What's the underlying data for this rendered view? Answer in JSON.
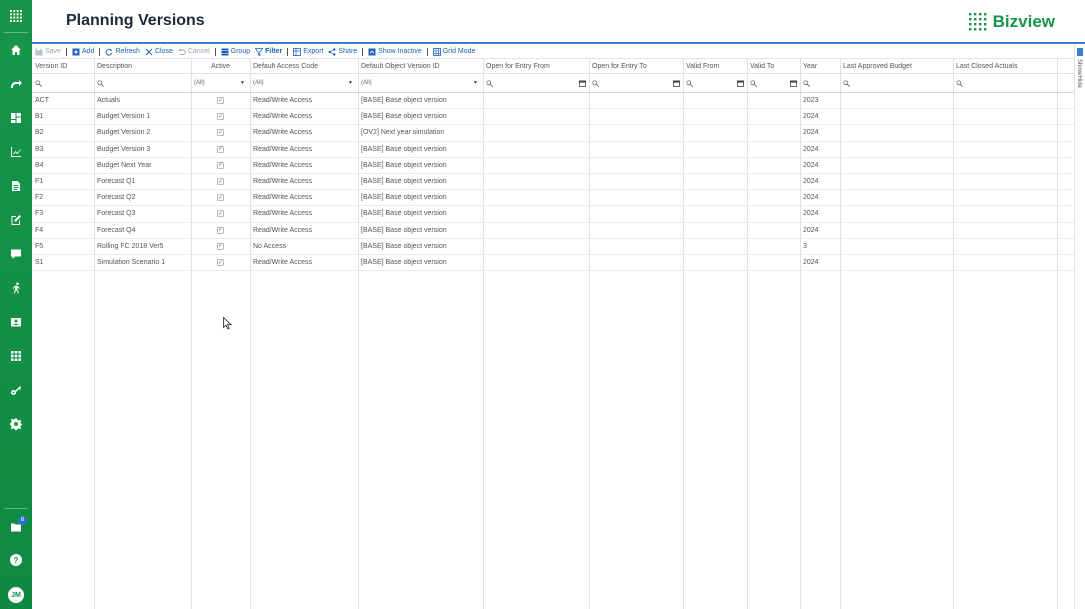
{
  "header": {
    "title": "Planning Versions",
    "brand": "Bizview"
  },
  "toolbar": {
    "save": "Save",
    "add": "Add",
    "refresh": "Refresh",
    "close": "Close",
    "cancel": "Cancel",
    "group": "Group",
    "filter": "Filter",
    "export": "Export",
    "share": "Share",
    "show_inactive": "Show Inactive",
    "grid_mode": "Grid Mode"
  },
  "right_panel": {
    "label": "Show/Hide"
  },
  "sidebar": {
    "badge": "6",
    "avatar": "JM",
    "help": "?"
  },
  "colors": {
    "accent": "#16964a",
    "link": "#1f5fb8",
    "header_line": "#3b7fd4"
  },
  "grid": {
    "columns": [
      "Version ID",
      "Description",
      "Active",
      "Default Access Code",
      "Default Object Version ID",
      "Open for Entry From",
      "Open for Entry To",
      "Valid From",
      "Valid To",
      "Year",
      "Last Approved Budget",
      "Last Closed Actuals"
    ],
    "filters": {
      "active": "(All)",
      "access": "(All)",
      "object": "(All)"
    },
    "rows": [
      {
        "id": "ACT",
        "desc": "Actuals",
        "active": true,
        "access": "Read/Write Access",
        "object": "[BASE] Base object version",
        "year": "2023"
      },
      {
        "id": "B1",
        "desc": "Budget Version 1",
        "active": true,
        "access": "Read/Write Access",
        "object": "[BASE] Base object version",
        "year": "2024"
      },
      {
        "id": "B2",
        "desc": "Budget Version 2",
        "active": true,
        "access": "Read/Write Access",
        "object": "[OV2] Next year simulation",
        "year": "2024"
      },
      {
        "id": "B3",
        "desc": "Budget Version 3",
        "active": true,
        "access": "Read/Write Access",
        "object": "[BASE] Base object version",
        "year": "2024"
      },
      {
        "id": "B4",
        "desc": "Budget Next Year",
        "active": true,
        "access": "Read/Write Access",
        "object": "[BASE] Base object version",
        "year": "2024"
      },
      {
        "id": "F1",
        "desc": "Forecast Q1",
        "active": true,
        "access": "Read/Write Access",
        "object": "[BASE] Base object version",
        "year": "2024"
      },
      {
        "id": "F2",
        "desc": "Forecast Q2",
        "active": true,
        "access": "Read/Write Access",
        "object": "[BASE] Base object version",
        "year": "2024"
      },
      {
        "id": "F3",
        "desc": "Forecast Q3",
        "active": true,
        "access": "Read/Write Access",
        "object": "[BASE] Base object version",
        "year": "2024"
      },
      {
        "id": "F4",
        "desc": "Forecast Q4",
        "active": true,
        "access": "Read/Write Access",
        "object": "[BASE] Base object version",
        "year": "2024"
      },
      {
        "id": "F5",
        "desc": "Rolling FC 2018 Ver5",
        "active": true,
        "access": "No Access",
        "object": "[BASE] Base object version",
        "year": "3"
      },
      {
        "id": "S1",
        "desc": "Simulation Scenario 1",
        "active": true,
        "access": "Read/Write Access",
        "object": "[BASE] Base object version",
        "year": "2024"
      }
    ]
  }
}
